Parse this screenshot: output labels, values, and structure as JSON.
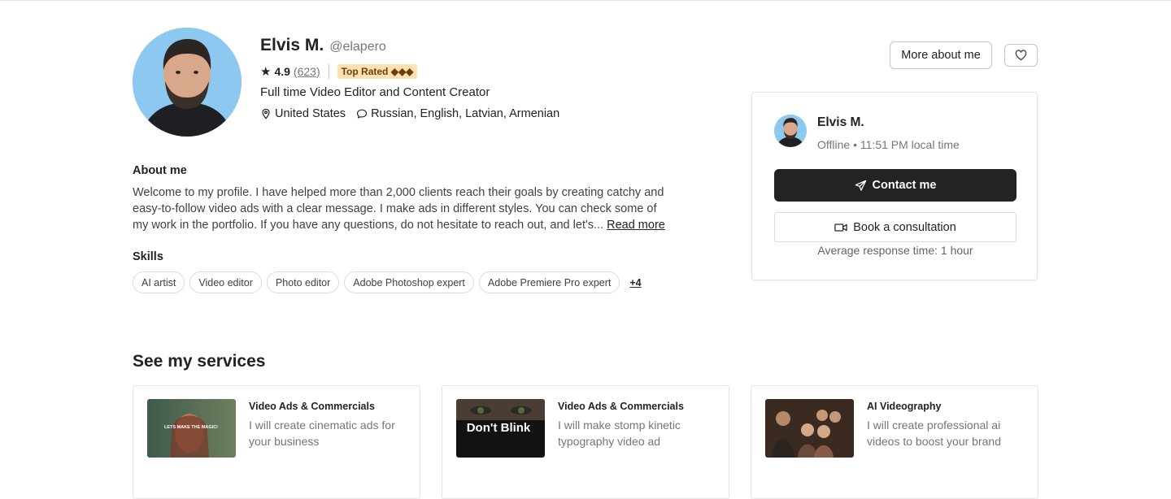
{
  "profile": {
    "name": "Elvis M.",
    "handle": "@elapero",
    "rating": "4.9",
    "reviews": "(623)",
    "badge": "Top Rated ◆◆◆",
    "tagline": "Full time Video Editor and Content Creator",
    "location": "United States",
    "languages": "Russian, English, Latvian, Armenian"
  },
  "about": {
    "title": "About me",
    "text": "Welcome to my profile. I have helped more than 2,000 clients reach their goals by creating catchy and easy-to-follow video ads with a clear message. I make ads in different styles. You can check some of my work in the portfolio. If you have any questions, do not hesitate to reach out, and let's...",
    "read_more": "Read more"
  },
  "skills": {
    "title": "Skills",
    "items": [
      "AI artist",
      "Video editor",
      "Photo editor",
      "Adobe Photoshop expert",
      "Adobe Premiere Pro expert"
    ],
    "more": "+4"
  },
  "actions": {
    "more_about": "More about me"
  },
  "contact_card": {
    "name": "Elvis M.",
    "status": "Offline • 11:51 PM local time",
    "contact_label": "Contact me",
    "book_label": "Book a consultation",
    "response_time": "Average response time: 1 hour"
  },
  "services": {
    "title": "See my services",
    "items": [
      {
        "category": "Video Ads & Commercials",
        "description": "I will create cinematic ads for your business",
        "thumb_text": "LETS MAKE THE MAGIC!"
      },
      {
        "category": "Video Ads & Commercials",
        "description": "I will make stomp kinetic typography video ad",
        "thumb_text": "Don't Blink"
      },
      {
        "category": "AI Videography",
        "description": "I will create professional ai videos to boost your brand",
        "thumb_text": ""
      }
    ]
  },
  "colors": {
    "primary_text": "#222325",
    "muted_text": "#74767e",
    "badge_bg": "#ffe0b3",
    "contact_bg": "#222325",
    "avatar_bg": "#8cc8f0"
  },
  "icons": [
    "star-icon",
    "location-pin-icon",
    "chat-bubble-icon",
    "heart-icon",
    "send-icon",
    "video-camera-icon"
  ]
}
